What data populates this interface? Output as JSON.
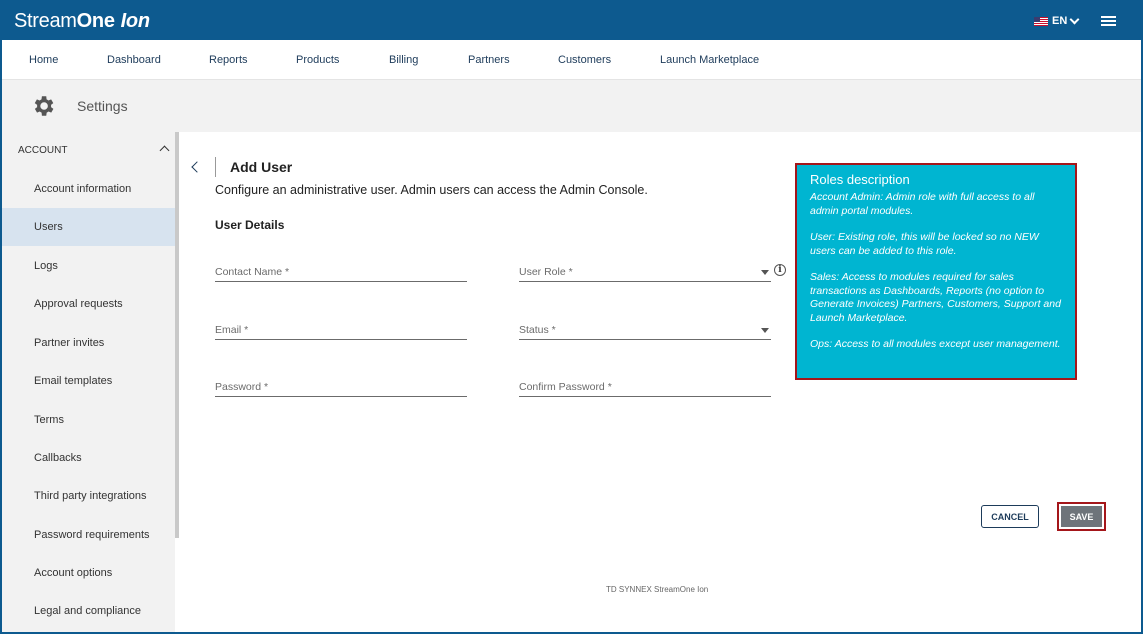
{
  "brand": {
    "name_regular": "Stream",
    "name_bold": "One",
    "name_suffix": "Ion"
  },
  "header": {
    "language": "EN",
    "flag_icon": "us-flag-icon",
    "menu_icon": "hamburger-menu-icon"
  },
  "nav": {
    "items": [
      {
        "label": "Home"
      },
      {
        "label": "Dashboard"
      },
      {
        "label": "Reports"
      },
      {
        "label": "Products"
      },
      {
        "label": "Billing"
      },
      {
        "label": "Partners"
      },
      {
        "label": "Customers"
      },
      {
        "label": "Launch Marketplace"
      }
    ]
  },
  "settings": {
    "title": "Settings",
    "icon": "gear-icon"
  },
  "sidebar": {
    "section": "ACCOUNT",
    "items": [
      {
        "label": "Account information"
      },
      {
        "label": "Users",
        "active": true
      },
      {
        "label": "Logs"
      },
      {
        "label": "Approval requests"
      },
      {
        "label": "Partner invites"
      },
      {
        "label": "Email templates"
      },
      {
        "label": "Terms"
      },
      {
        "label": "Callbacks"
      },
      {
        "label": "Third party integrations"
      },
      {
        "label": "Password requirements"
      },
      {
        "label": "Account options"
      },
      {
        "label": "Legal and compliance"
      }
    ]
  },
  "main": {
    "title": "Add User",
    "subtitle": "Configure an administrative user. Admin users can access the Admin Console.",
    "section_title": "User Details",
    "fields": {
      "contact_name": {
        "placeholder": "Contact Name *",
        "value": ""
      },
      "user_role": {
        "placeholder": "User Role *",
        "value": ""
      },
      "email": {
        "placeholder": "Email *",
        "value": ""
      },
      "status": {
        "placeholder": "Status *",
        "value": ""
      },
      "password": {
        "placeholder": "Password *",
        "value": ""
      },
      "confirm_password": {
        "placeholder": "Confirm Password *",
        "value": ""
      }
    },
    "cancel_label": "CANCEL",
    "save_label": "SAVE"
  },
  "roles_tooltip": {
    "title": "Roles description",
    "items": [
      "Account Admin: Admin role with full access to all admin portal modules.",
      "User: Existing role, this will be locked so no NEW users can be added to this role.",
      "Sales: Access to modules required for sales transactions as Dashboards, Reports (no option to Generate Invoices) Partners, Customers, Support and Launch Marketplace.",
      "Ops: Access to all modules except user management."
    ]
  },
  "footer": {
    "text": "TD SYNNEX StreamOne Ion"
  },
  "colors": {
    "brand_blue": "#0d5a8f",
    "tooltip_bg": "#00b5d1",
    "highlight_red": "#a4161a",
    "active_row": "#d7e3ef",
    "save_button": "#6e747a"
  }
}
